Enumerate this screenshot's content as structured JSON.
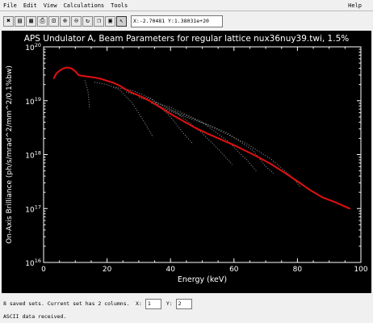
{
  "menubar": {
    "items": [
      "File",
      "Edit",
      "View",
      "Calculations",
      "Tools"
    ],
    "help": "Help"
  },
  "toolbar": {
    "buttons": [
      {
        "name": "close-icon",
        "glyph": "✖"
      },
      {
        "name": "open-icon",
        "glyph": "▤"
      },
      {
        "name": "save-icon",
        "glyph": "▦"
      },
      {
        "name": "print-icon",
        "glyph": "⎙"
      },
      {
        "name": "zoom-fit-icon",
        "glyph": "⊡"
      },
      {
        "name": "zoom-in-icon",
        "glyph": "⊕"
      },
      {
        "name": "zoom-out-icon",
        "glyph": "⊖"
      },
      {
        "name": "refresh-icon",
        "glyph": "↻"
      },
      {
        "name": "copy-icon",
        "glyph": "❐"
      },
      {
        "name": "window-icon",
        "glyph": "▣"
      },
      {
        "name": "cursor-icon",
        "glyph": "↖",
        "pressed": true
      }
    ],
    "coordinates": "X:-2.70481 Y:1.38031e+20"
  },
  "chart_data": {
    "type": "line",
    "title": "APS Undulator A, Beam Parameters for regular lattice nux36nuy39.twi, 1.5%",
    "xlabel": "Energy (keV)",
    "ylabel": "On-Axis Brilliance (ph/s/mrad^2/mm^2/0.1%bw)",
    "xlim": [
      0,
      100
    ],
    "ylim": [
      1e+16,
      1e+20
    ],
    "yscale": "log",
    "xticks": [
      0,
      20,
      40,
      60,
      80,
      100
    ],
    "ytick_labels": [
      {
        "base": "10",
        "exp": "16",
        "value": 1e+16
      },
      {
        "base": "10",
        "exp": "17",
        "value": 1e+17
      },
      {
        "base": "10",
        "exp": "18",
        "value": 1e+18
      },
      {
        "base": "10",
        "exp": "19",
        "value": 1e+19
      },
      {
        "base": "10",
        "exp": "20",
        "value": 1e+20
      }
    ],
    "background": "#000000",
    "axis_color": "#ffffff",
    "envelope_color": "#e01010",
    "harmonic_color": "#9a9a9a",
    "envelope": {
      "x": [
        3.2,
        4,
        5,
        6,
        7,
        8,
        9,
        10,
        11,
        12,
        13,
        14,
        16,
        18,
        20,
        22,
        24,
        26,
        28,
        30,
        32,
        34,
        36,
        38,
        40,
        44,
        48,
        52,
        56,
        60,
        64,
        68,
        72,
        76,
        80,
        84,
        88,
        92,
        96.5
      ],
      "y": [
        2.6e+19,
        3.2e+19,
        3.6e+19,
        3.9e+19,
        4.1e+19,
        4.1e+19,
        3.9e+19,
        3.5e+19,
        3e+19,
        2.9e+19,
        2.85e+19,
        2.8e+19,
        2.7e+19,
        2.55e+19,
        2.35e+19,
        2.15e+19,
        1.9e+19,
        1.6e+19,
        1.4e+19,
        1.25e+19,
        1.1e+19,
        9.5e+18,
        8e+18,
        6.8e+18,
        5.7e+18,
        4.2e+18,
        3.1e+18,
        2.4e+18,
        1.9e+18,
        1.5e+18,
        1.15e+18,
        8.8e+17,
        6.5e+17,
        4.6e+17,
        3.2e+17,
        2.2e+17,
        1.6e+17,
        1.3e+17,
        1e+17
      ]
    },
    "harmonics": [
      {
        "x": [
          13,
          14,
          14.5
        ],
        "y": [
          2.4e+19,
          1.5e+19,
          7e+18
        ]
      },
      {
        "x": [
          16,
          20,
          24,
          28,
          32,
          34.5
        ],
        "y": [
          2.2e+19,
          2e+19,
          1.6e+19,
          9e+18,
          3.8e+18,
          2.1e+18
        ]
      },
      {
        "x": [
          22,
          28,
          34,
          40,
          44,
          47
        ],
        "y": [
          1.8e+19,
          1.55e+19,
          1.1e+19,
          5e+18,
          2.5e+18,
          1.6e+18
        ]
      },
      {
        "x": [
          26,
          34,
          42,
          50,
          56,
          59.5
        ],
        "y": [
          1.45e+19,
          1.05e+19,
          6e+18,
          2.5e+18,
          1.1e+18,
          6.5e+17
        ]
      },
      {
        "x": [
          30,
          40,
          50,
          58,
          64,
          67
        ],
        "y": [
          1.15e+19,
          7.5e+18,
          4e+18,
          1.8e+18,
          8e+17,
          5e+17
        ]
      },
      {
        "x": [
          34,
          46,
          58,
          66,
          70,
          72.5
        ],
        "y": [
          9e+18,
          5e+18,
          2.5e+18,
          1.2e+18,
          6e+17,
          4.5e+17
        ]
      },
      {
        "x": [
          38,
          52,
          64,
          72,
          78,
          81
        ],
        "y": [
          7e+18,
          3.5e+18,
          1.6e+18,
          8e+17,
          4e+17,
          2.5e+17
        ]
      }
    ]
  },
  "status": {
    "sets_text": "8  saved sets. Current set has  2  columns.",
    "x_label": "X:",
    "x_value": "1",
    "y_label": "Y:",
    "y_value": "2",
    "message": "ASCII data received."
  }
}
